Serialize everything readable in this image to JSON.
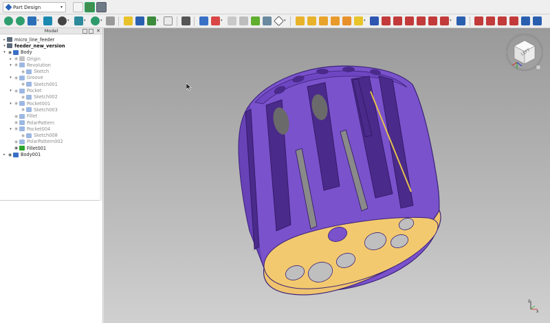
{
  "workbench": {
    "selected": "Part Design",
    "dropdown_icon": "chevron-down-icon"
  },
  "colors": {
    "body_purple": "#7a52cc",
    "body_dark": "#5a34a6",
    "cap_yellow": "#f0c46e",
    "highlight_green": "#2aa52a",
    "background_top": "#9a9a9a",
    "background_bottom": "#d0d0d0"
  },
  "model_panel": {
    "title": "Model",
    "close_label": "✕",
    "tree": [
      {
        "label": "micro_line_feeder",
        "level": 0,
        "arrow": "▸",
        "style": "normal",
        "icon": "document-icon"
      },
      {
        "label": "feeder_new_version",
        "level": 0,
        "arrow": "▾",
        "style": "bold",
        "icon": "document-icon"
      },
      {
        "label": "Body",
        "level": 1,
        "arrow": "▾",
        "style": "normal",
        "icon": "body-icon",
        "eye": true
      },
      {
        "label": "Origin",
        "level": 2,
        "arrow": "▸",
        "style": "dim",
        "icon": "origin-icon",
        "eye": false
      },
      {
        "label": "Revolution",
        "level": 2,
        "arrow": "▾",
        "style": "dim",
        "icon": "revolution-icon",
        "eye": false
      },
      {
        "label": "Sketch",
        "level": 3,
        "arrow": "",
        "style": "dim",
        "icon": "sketch-icon",
        "eye": false
      },
      {
        "label": "Groove",
        "level": 2,
        "arrow": "▾",
        "style": "dim",
        "icon": "groove-icon",
        "eye": false
      },
      {
        "label": "Sketch001",
        "level": 3,
        "arrow": "",
        "style": "dim",
        "icon": "sketch-icon",
        "eye": false
      },
      {
        "label": "Pocket",
        "level": 2,
        "arrow": "▾",
        "style": "dim",
        "icon": "pocket-icon",
        "eye": false
      },
      {
        "label": "Sketch002",
        "level": 3,
        "arrow": "",
        "style": "dim",
        "icon": "sketch-icon",
        "eye": false
      },
      {
        "label": "Pocket001",
        "level": 2,
        "arrow": "▾",
        "style": "dim",
        "icon": "pocket-icon",
        "eye": false
      },
      {
        "label": "Sketch003",
        "level": 3,
        "arrow": "",
        "style": "dim",
        "icon": "sketch-icon",
        "eye": false
      },
      {
        "label": "Fillet",
        "level": 2,
        "arrow": "",
        "style": "dim",
        "icon": "fillet-icon",
        "eye": false
      },
      {
        "label": "PolarPattern",
        "level": 2,
        "arrow": "",
        "style": "dim",
        "icon": "polarpattern-icon",
        "eye": false
      },
      {
        "label": "Pocket004",
        "level": 2,
        "arrow": "▾",
        "style": "dim",
        "icon": "pocket-icon",
        "eye": false
      },
      {
        "label": "Sketch008",
        "level": 3,
        "arrow": "",
        "style": "dim",
        "icon": "sketch-icon",
        "eye": false
      },
      {
        "label": "PolarPattern002",
        "level": 2,
        "arrow": "",
        "style": "dim",
        "icon": "polarpattern-icon",
        "eye": false
      },
      {
        "label": "Fillet001",
        "level": 2,
        "arrow": "",
        "style": "normal",
        "icon": "fillet-icon",
        "eye": true
      },
      {
        "label": "Body001",
        "level": 1,
        "arrow": "▸",
        "style": "normal",
        "icon": "body-icon",
        "eye": true
      }
    ]
  },
  "navcube": {
    "face_label": "LEFT"
  },
  "axes": {
    "z": "Z",
    "x": "X"
  }
}
